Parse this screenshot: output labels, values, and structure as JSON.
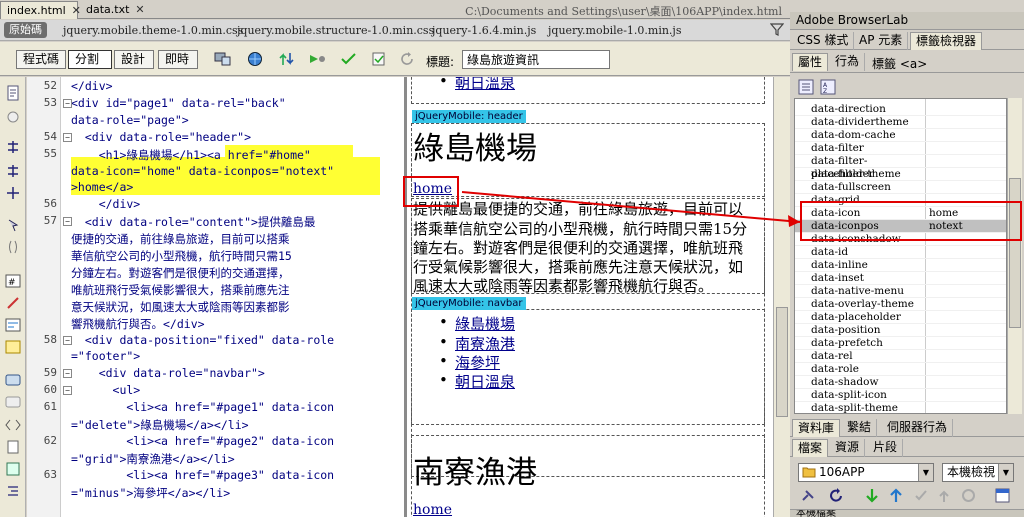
{
  "tabs": [
    {
      "label": "index.html",
      "close": "✕"
    },
    {
      "label": "data.txt",
      "close": "✕"
    }
  ],
  "file_path": "C:\\Documents and Settings\\user\\桌面\\106APP\\index.html",
  "related_files": {
    "source": "原始碼",
    "files": [
      "jquery.mobile.theme-1.0.min.css",
      "jquery.mobile.structure-1.0.min.css",
      "jquery-1.6.4.min.js",
      "jquery.mobile-1.0.min.js"
    ]
  },
  "view_buttons": [
    "程式碼",
    "分割",
    "設計",
    "即時"
  ],
  "title_label": "標題:",
  "title_value": "綠島旅遊資訊",
  "code_lines": [
    {
      "num": "52",
      "text": "</div>"
    },
    {
      "num": "53",
      "text": "<div id=\"page1\" data-rel=\"back\""
    },
    {
      "num": "",
      "text": "data-role=\"page\">"
    },
    {
      "num": "54",
      "text": "  <div data-role=\"header\">"
    },
    {
      "num": "55",
      "text": "    <h1>綠島機場</h1><a href=\"#home\""
    },
    {
      "num": "",
      "text": "data-icon=\"home\" data-iconpos=\"notext\""
    },
    {
      "num": "",
      "text": ">home</a>"
    },
    {
      "num": "56",
      "text": "    </div>"
    },
    {
      "num": "57",
      "text": "  <div data-role=\"content\">提供離島最"
    },
    {
      "num": "",
      "text": "便捷的交通，前往綠島旅遊，目前可以搭乘"
    },
    {
      "num": "",
      "text": "華信航空公司的小型飛機，航行時間只需15"
    },
    {
      "num": "",
      "text": "分鐘左右。對遊客們是很便利的交通選擇，"
    },
    {
      "num": "",
      "text": "唯航班飛行受氣候影響很大，搭乘前應先注"
    },
    {
      "num": "",
      "text": "意天候狀況，如風速太大或陰雨等因素都影"
    },
    {
      "num": "",
      "text": "響飛機航行與否。</div>"
    },
    {
      "num": "58",
      "text": "  <div data-position=\"fixed\" data-role"
    },
    {
      "num": "",
      "text": "=\"footer\">"
    },
    {
      "num": "59",
      "text": "    <div data-role=\"navbar\">"
    },
    {
      "num": "60",
      "text": "      <ul>"
    },
    {
      "num": "61",
      "text": "        <li><a href=\"#page1\" data-icon"
    },
    {
      "num": "",
      "text": "=\"delete\">綠島機場</a></li>"
    },
    {
      "num": "62",
      "text": "        <li><a href=\"#page2\" data-icon"
    },
    {
      "num": "",
      "text": "=\"grid\">南寮漁港</a></li>"
    },
    {
      "num": "63",
      "text": "        <li><a href=\"#page3\" data-icon"
    },
    {
      "num": "",
      "text": "=\"minus\">海參坪</a></li>"
    }
  ],
  "design": {
    "top_link": "朝日溫泉",
    "header_tag": "jQueryMobile: header",
    "page_title": "綠島機場",
    "home_link": "home",
    "content_lines": [
      "提供離島最便捷的交通，前往綠島旅遊，目前可以",
      "搭乘華信航空公司的小型飛機，航行時間只需15分",
      "鐘左右。對遊客們是很便利的交通選擇，唯航班飛",
      "行受氣候影響很大，搭乘前應先注意天候狀況，如",
      "風速太大或陰雨等因素都影響飛機航行與否。"
    ],
    "navbar_tag": "jQueryMobile: navbar",
    "nav_items": [
      "綠島機場",
      "南寮漁港",
      "海參坪",
      "朝日溫泉"
    ],
    "page2_title": "南寮漁港",
    "page2_home": "home"
  },
  "right_panel": {
    "browserlab": "Adobe BrowserLab",
    "panel_tabs": [
      "CSS 樣式",
      "AP 元素",
      "標籤檢視器"
    ],
    "sub_tabs": [
      "屬性",
      "行為"
    ],
    "tag_label": "標籤 <a>",
    "attributes": [
      {
        "name": "data-direction",
        "value": ""
      },
      {
        "name": "data-dividertheme",
        "value": ""
      },
      {
        "name": "data-dom-cache",
        "value": ""
      },
      {
        "name": "data-filter",
        "value": ""
      },
      {
        "name": "data-filter-placeholder",
        "value": ""
      },
      {
        "name": "data-filter-theme",
        "value": ""
      },
      {
        "name": "data-fullscreen",
        "value": ""
      },
      {
        "name": "data-grid",
        "value": ""
      },
      {
        "name": "data-icon",
        "value": "home"
      },
      {
        "name": "data-iconpos",
        "value": "notext"
      },
      {
        "name": "data-iconshadow",
        "value": ""
      },
      {
        "name": "data-id",
        "value": ""
      },
      {
        "name": "data-inline",
        "value": ""
      },
      {
        "name": "data-inset",
        "value": ""
      },
      {
        "name": "data-native-menu",
        "value": ""
      },
      {
        "name": "data-overlay-theme",
        "value": ""
      },
      {
        "name": "data-placeholder",
        "value": ""
      },
      {
        "name": "data-position",
        "value": ""
      },
      {
        "name": "data-prefetch",
        "value": ""
      },
      {
        "name": "data-rel",
        "value": ""
      },
      {
        "name": "data-role",
        "value": ""
      },
      {
        "name": "data-shadow",
        "value": ""
      },
      {
        "name": "data-split-icon",
        "value": ""
      },
      {
        "name": "data-split-theme",
        "value": ""
      }
    ],
    "asset_tabs": [
      "資料庫",
      "繫結",
      "伺服器行為"
    ],
    "file_tabs": [
      "檔案",
      "資源",
      "片段"
    ],
    "site_name": "106APP",
    "view_mode": "本機檢視",
    "bottom_header": "本機檔案"
  }
}
